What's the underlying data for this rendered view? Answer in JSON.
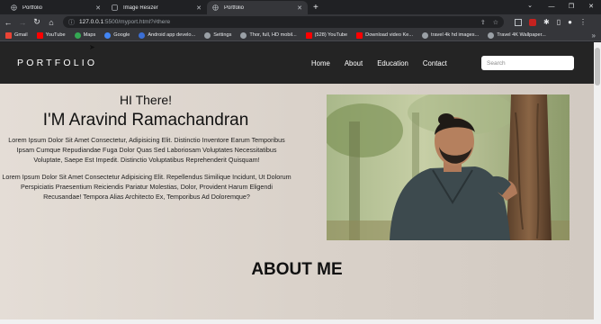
{
  "browser": {
    "tabs": [
      {
        "title": "Portfolio",
        "active": false
      },
      {
        "title": "Image Resizer",
        "active": false
      },
      {
        "title": "Portfolio",
        "active": true
      }
    ],
    "address": {
      "host": "127.0.0.1",
      "path": ":5500/myport.html?#there"
    },
    "bookmarks": [
      {
        "label": "Gmail",
        "color": "#ea4335"
      },
      {
        "label": "YouTube",
        "color": "#ff0000"
      },
      {
        "label": "Maps",
        "color": "#34a853"
      },
      {
        "label": "Google",
        "color": "#4285f4"
      },
      {
        "label": "Android app develo...",
        "color": "#3b6fd6"
      },
      {
        "label": "Settings",
        "color": "#9aa0a6"
      },
      {
        "label": "Thor, full, HD mobil...",
        "color": "#9aa0a6"
      },
      {
        "label": "(528) YouTube",
        "color": "#ff0000"
      },
      {
        "label": "Download video Ke...",
        "color": "#ff0000"
      },
      {
        "label": "travel 4k hd images...",
        "color": "#9aa0a6"
      },
      {
        "label": "Travel 4K Wallpaper...",
        "color": "#9aa0a6"
      }
    ]
  },
  "site": {
    "brand": "PORTFOLIO",
    "menu": [
      "Home",
      "About",
      "Education",
      "Contact"
    ],
    "search_placeholder": "Search",
    "hero": {
      "greeting": "HI There!",
      "name": "I'M Aravind Ramachandran",
      "paragraph1": "Lorem Ipsum Dolor Sit Amet Consectetur, Adipisicing Elit. Distinctio Inventore Earum Temporibus Ipsam Cumque Repudiandae Fuga Dolor Quas Sed Laboriosam Voluptates Necessitatibus Voluptate, Saepe Est Impedit. Distinctio Voluptatibus Reprehenderit Quisquam!",
      "paragraph2": "Lorem Ipsum Dolor Sit Amet Consectetur Adipisicing Elit. Repellendus Similique Incidunt, Ut Dolorum Perspiciatis Praesentium Reiciendis Pariatur Molestias, Dolor, Provident Harum Eligendi Recusandae! Tempora Alias Architecto Ex, Temporibus Ad Doloremque?"
    },
    "about_heading": "ABOUT ME"
  }
}
